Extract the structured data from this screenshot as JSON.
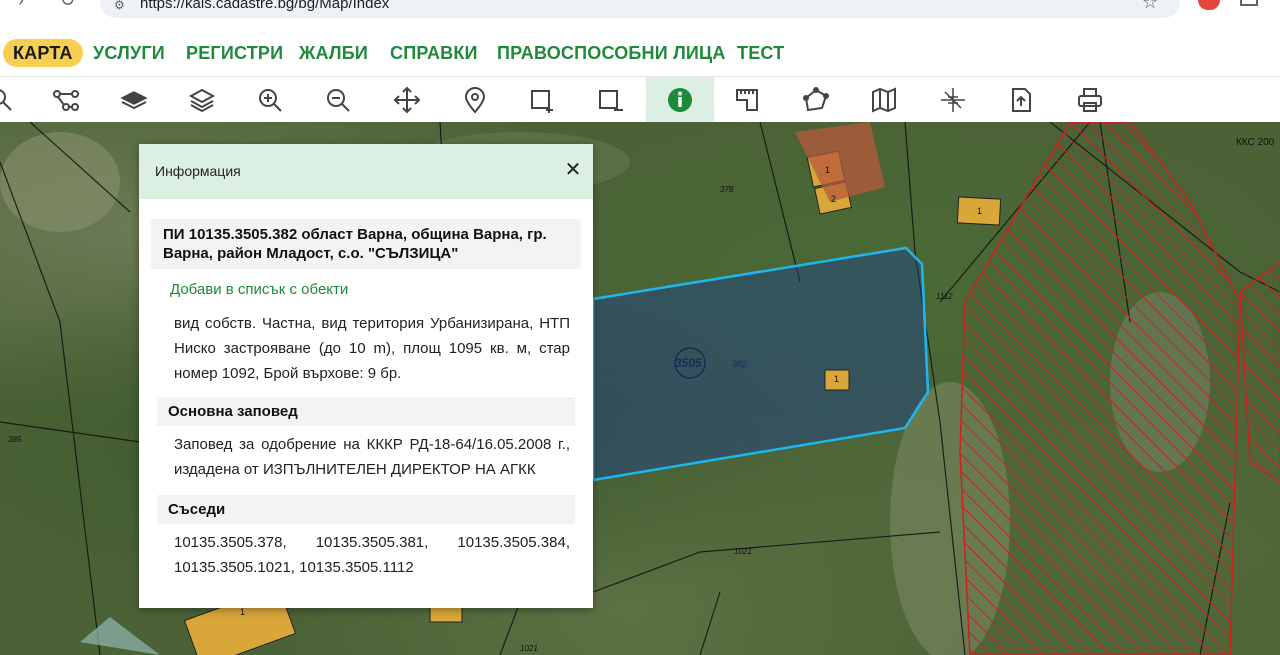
{
  "browser": {
    "url": "https://kais.cadastre.bg/bg/Map/Index"
  },
  "menu": {
    "items": [
      "КАРТА",
      "УСЛУГИ",
      "РЕГИСТРИ",
      "ЖАЛБИ",
      "СПРАВКИ",
      "ПРАВОСПОСОБНИ ЛИЦА",
      "ТЕСТ"
    ],
    "active": "КАРТА",
    "accent_color": "#1f8a3c",
    "active_color": "#f6cf52"
  },
  "toolbar": {
    "tools": [
      "search-icon",
      "route-icon",
      "layer-icon",
      "layers-stack-icon",
      "zoom-in-icon",
      "zoom-out-icon",
      "pan-icon",
      "location-pin-icon",
      "add-area-icon",
      "remove-area-icon",
      "info-icon",
      "measure-icon",
      "polygon-icon",
      "map-book-icon",
      "crosshair-icon",
      "export-icon",
      "print-icon"
    ],
    "active_tool": "info-icon"
  },
  "info_panel": {
    "title": "Информация",
    "parcel_heading": "ПИ 10135.3505.382 област Варна, община Варна, гр. Варна, район Младост, с.о. \"СЪЛЗИЦА\"",
    "add_link": "Добави в списък с обекти",
    "description": "вид собств. Частна, вид територия Урбанизирана, НТП Ниско застрояване (до 10 m), площ 1095 кв. м, стар номер 1092, Брой върхове: 9 бр.",
    "order_heading": "Основна заповед",
    "order_text": "Заповед за одобрение на КККР РД-18-64/16.05.2008 г., издадена от ИЗПЪЛНИТЕЛЕН ДИРЕКТОР НА АГКК",
    "neighbors_heading": "Съседи",
    "neighbors_text": "10135.3505.378, 10135.3505.381, 10135.3505.384, 10135.3505.1021, 10135.3505.1112"
  },
  "map": {
    "labels": {
      "district": "3505",
      "parcel": "382",
      "p378": "378",
      "p1112": "1112",
      "p1021": "1021",
      "p1021b": "1021",
      "p385": "385",
      "kks": "ККС 200",
      "b1a": "1",
      "b2": "2",
      "b1b": "1",
      "b1c": "1",
      "b1d": "1"
    },
    "highlight_color": "#1fb6f0",
    "building_color": "#d9a63a",
    "hatch_color": "#d0201e"
  }
}
